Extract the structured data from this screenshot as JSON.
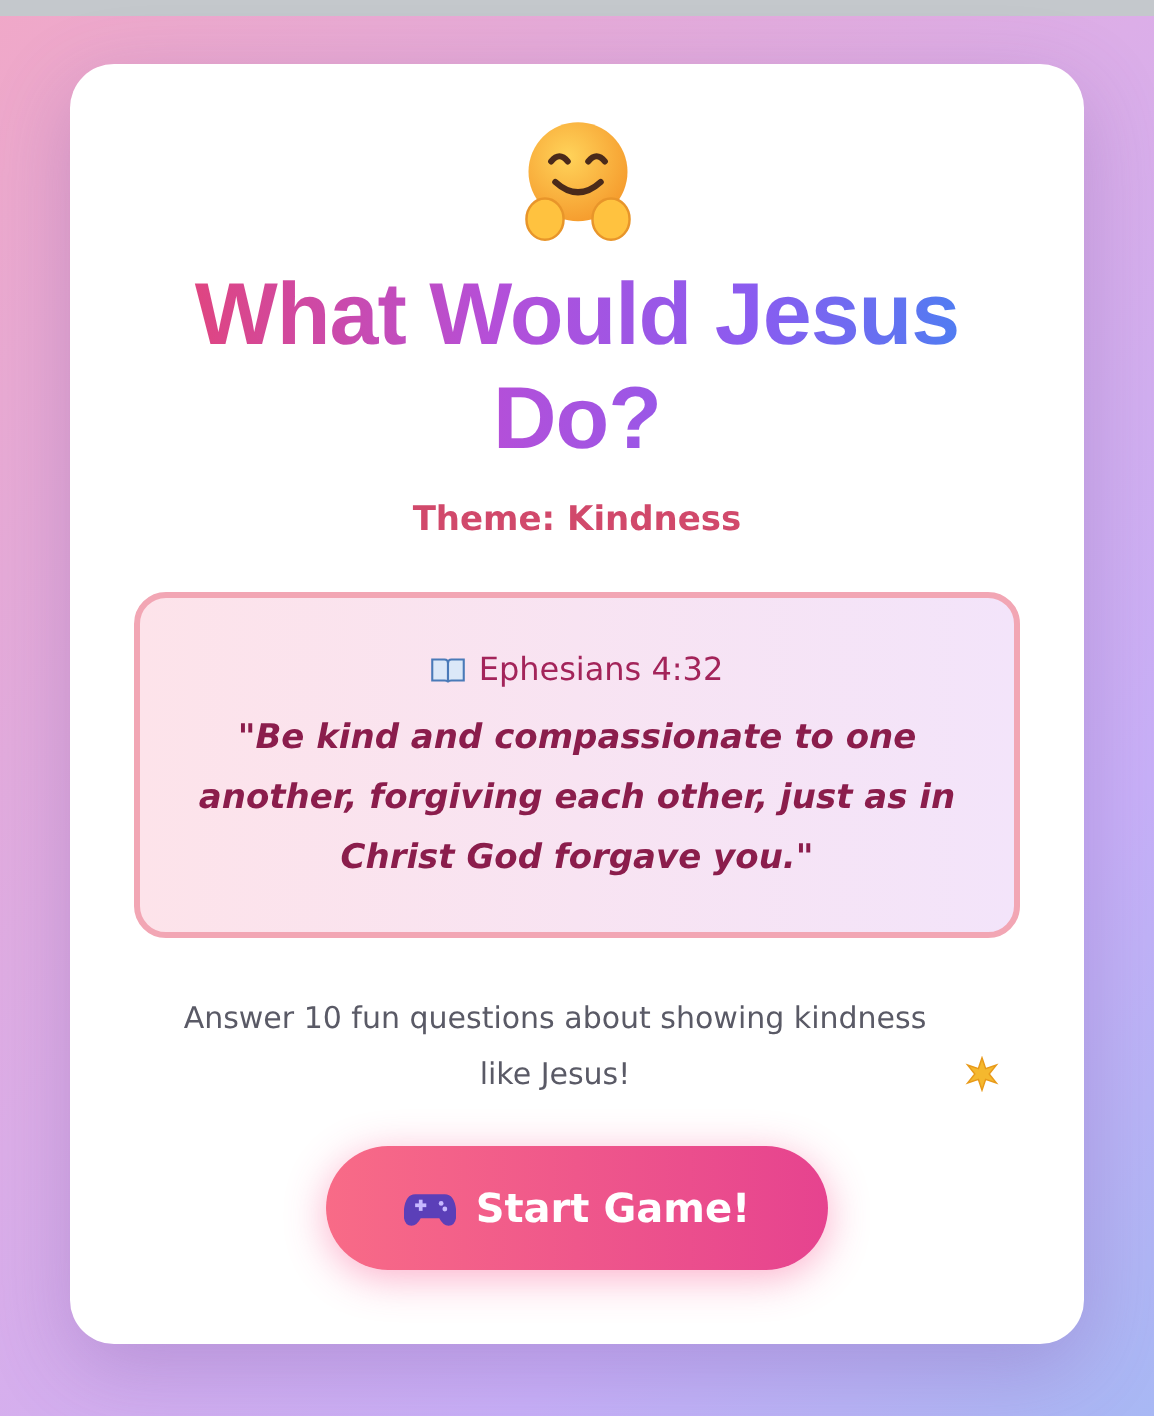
{
  "title": "What Would Jesus Do?",
  "theme": "Theme: Kindness",
  "scripture": {
    "reference": "Ephesians 4:32",
    "text": "\"Be kind and compassionate to one another, forgiving each other, just as in Christ God forgave you.\""
  },
  "description": "Answer 10 fun questions about showing kindness like Jesus!",
  "start_button": {
    "label": "Start Game!"
  }
}
